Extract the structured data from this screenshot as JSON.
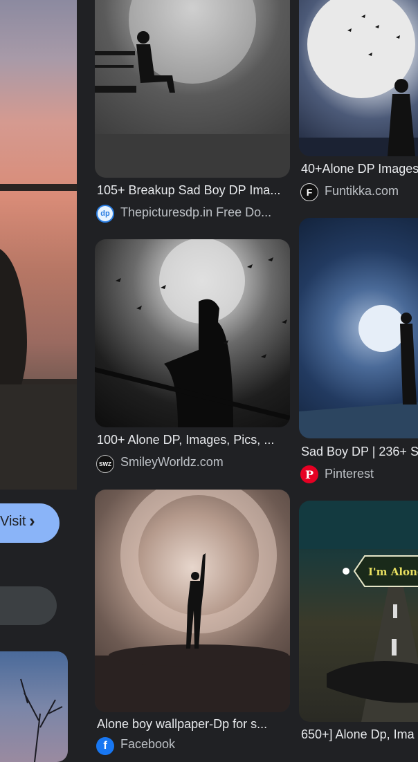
{
  "left_panel": {
    "visit_label": "Visit",
    "visit_chevron": "›"
  },
  "results": [
    {
      "title": "105+ Breakup Sad Boy DP Ima...",
      "source": "Thepicturesdp.in Free Do...",
      "favicon": "dp"
    },
    {
      "title": "40+Alone DP Images",
      "source": "Funtikka.com",
      "favicon": "F"
    },
    {
      "title": "100+ Alone DP, Images, Pics, ...",
      "source": "SmileyWorldz.com",
      "favicon": "SWZ"
    },
    {
      "title": "Sad Boy DP | 236+ S",
      "source": "Pinterest",
      "favicon": "P"
    },
    {
      "title": "Alone boy wallpaper-Dp for s...",
      "source": "Facebook",
      "favicon": "f"
    },
    {
      "title": "650+] Alone Dp, Ima",
      "source": "",
      "favicon": ""
    }
  ],
  "image_texts": {
    "im_alone": "I'm Alone"
  },
  "colors": {
    "background": "#202124",
    "visit_button": "#8ab4f8",
    "pinterest": "#e60023",
    "facebook": "#1877f2"
  }
}
